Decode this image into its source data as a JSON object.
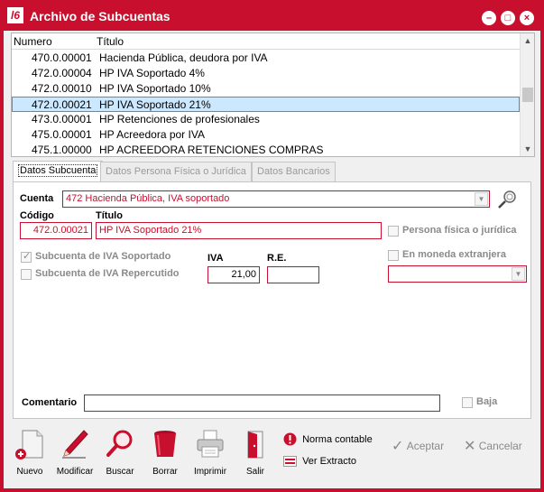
{
  "window": {
    "logo": "l6",
    "title": "Archivo de Subcuentas",
    "controls": [
      "–",
      "□",
      "×"
    ]
  },
  "list": {
    "headers": [
      "Numero",
      "Título"
    ],
    "rows": [
      {
        "code": "470.0.00001",
        "name": "Hacienda Pública, deudora por IVA"
      },
      {
        "code": "472.0.00004",
        "name": "HP IVA Soportado 4%"
      },
      {
        "code": "472.0.00010",
        "name": "HP IVA Soportado 10%"
      },
      {
        "code": "472.0.00021",
        "name": "HP IVA Soportado 21%"
      },
      {
        "code": "473.0.00001",
        "name": "HP Retenciones de profesionales"
      },
      {
        "code": "475.0.00001",
        "name": "HP Acreedora por IVA"
      },
      {
        "code": "475.1.00000",
        "name": "HP ACREEDORA RETENCIONES COMPRAS"
      }
    ],
    "selected_index": 3
  },
  "tabs": [
    "Datos Subcuenta",
    "Datos Persona Física o Jurídica",
    "Datos Bancarios"
  ],
  "form": {
    "cuenta_label": "Cuenta",
    "cuenta_value": "472   Hacienda Pública, IVA soportado",
    "codigo_label": "Código",
    "codigo_value": "472.0.00021",
    "titulo_label": "Título",
    "titulo_value": "HP IVA Soportado 21%",
    "persona_label": "Persona física o jurídica",
    "moneda_label": "En moneda extranjera",
    "soportado_label": "Subcuenta de IVA Soportado",
    "repercutido_label": "Subcuenta de IVA Repercutido",
    "iva_label": "IVA",
    "iva_value": "21,00",
    "re_label": "R.E.",
    "re_value": "",
    "moneda_value": "",
    "comentario_label": "Comentario",
    "comentario_value": "",
    "baja_label": "Baja"
  },
  "toolbar": {
    "nuevo": "Nuevo",
    "modificar": "Modificar",
    "buscar": "Buscar",
    "borrar": "Borrar",
    "imprimir": "Imprimir",
    "salir": "Salir",
    "norma_contable": "Norma contable",
    "ver_extracto": "Ver Extracto",
    "aceptar": "Aceptar",
    "cancelar": "Cancelar"
  },
  "colors": {
    "brand": "#c8102e",
    "selection": "#cce8ff",
    "disabled": "#8a8a8a"
  }
}
